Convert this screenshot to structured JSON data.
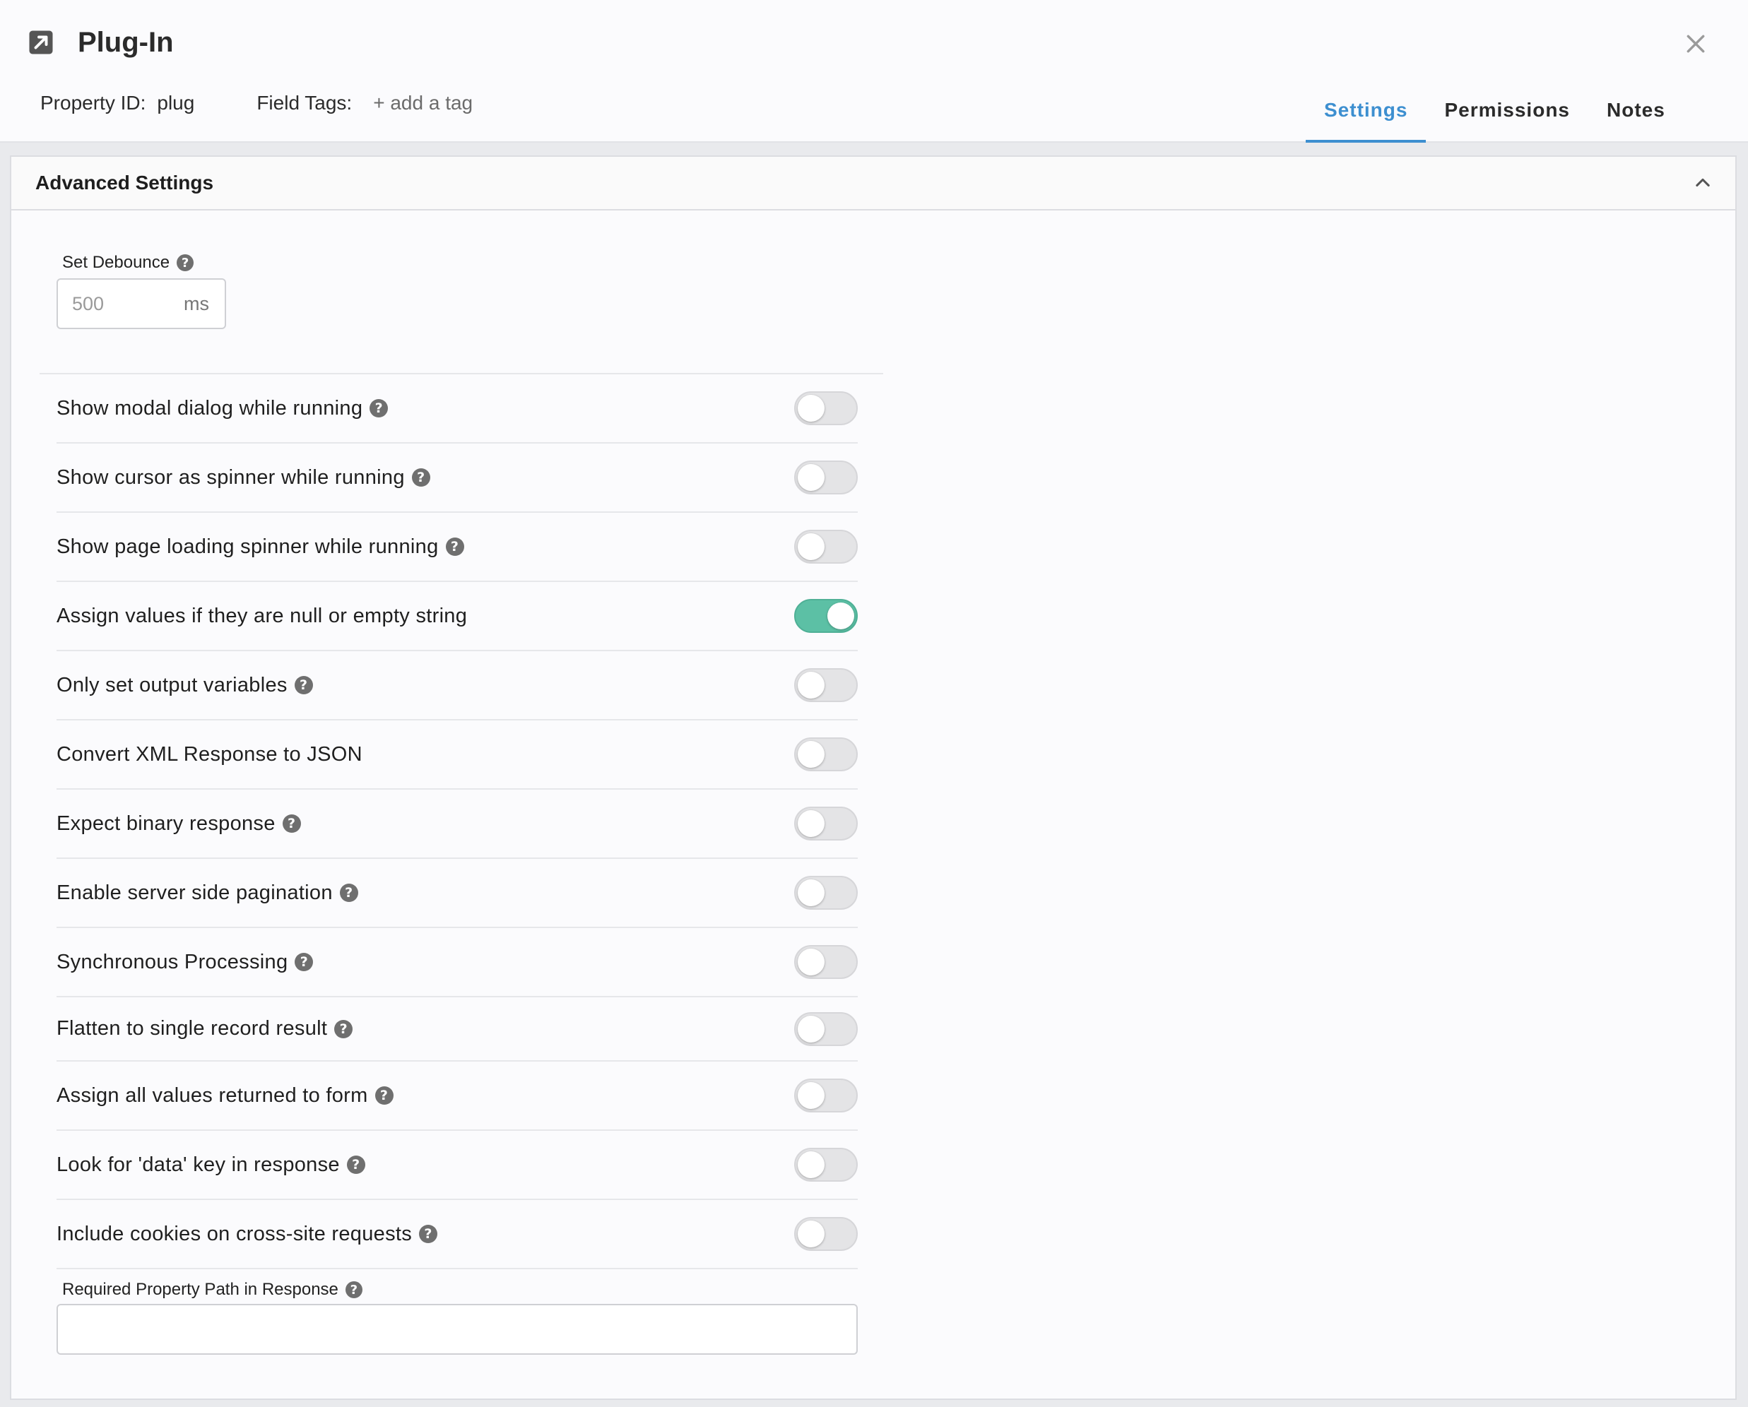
{
  "header": {
    "title": "Plug-In",
    "property_id_label": "Property ID:",
    "property_id_value": "plug",
    "field_tags_label": "Field Tags:",
    "add_tag_label": "+ add a tag",
    "title_icon": "external-link-icon",
    "close_icon": "close-icon"
  },
  "tabs": [
    {
      "label": "Settings",
      "active": true
    },
    {
      "label": "Permissions",
      "active": false
    },
    {
      "label": "Notes",
      "active": false
    }
  ],
  "panel": {
    "title": "Advanced Settings",
    "collapse_icon": "chevron-up-icon",
    "debounce": {
      "label": "Set Debounce",
      "placeholder": "500",
      "value": "",
      "unit": "ms"
    },
    "toggles": [
      {
        "label": "Show modal dialog while running",
        "help": true,
        "on": false
      },
      {
        "label": "Show cursor as spinner while running",
        "help": true,
        "on": false
      },
      {
        "label": "Show page loading spinner while running",
        "help": true,
        "on": false
      },
      {
        "label": "Assign values if they are null or empty string",
        "help": false,
        "on": true
      },
      {
        "label": "Only set output variables",
        "help": true,
        "on": false
      },
      {
        "label": "Convert XML Response to JSON",
        "help": false,
        "on": false
      },
      {
        "label": "Expect binary response",
        "help": true,
        "on": false
      },
      {
        "label": "Enable server side pagination",
        "help": true,
        "on": false
      },
      {
        "label": "Synchronous Processing",
        "help": true,
        "on": false
      },
      {
        "label": "Flatten to single record result",
        "help": true,
        "on": false
      },
      {
        "label": "Assign all values returned to form",
        "help": true,
        "on": false
      },
      {
        "label": "Look for 'data' key in response",
        "help": true,
        "on": false
      },
      {
        "label": "Include cookies on cross-site requests",
        "help": true,
        "on": false
      }
    ],
    "required_path": {
      "label": "Required Property Path in Response",
      "value": ""
    }
  },
  "colors": {
    "accent": "#3d8fd0",
    "toggle_on": "#5cc0a5",
    "toggle_off": "#e4e4e6"
  }
}
